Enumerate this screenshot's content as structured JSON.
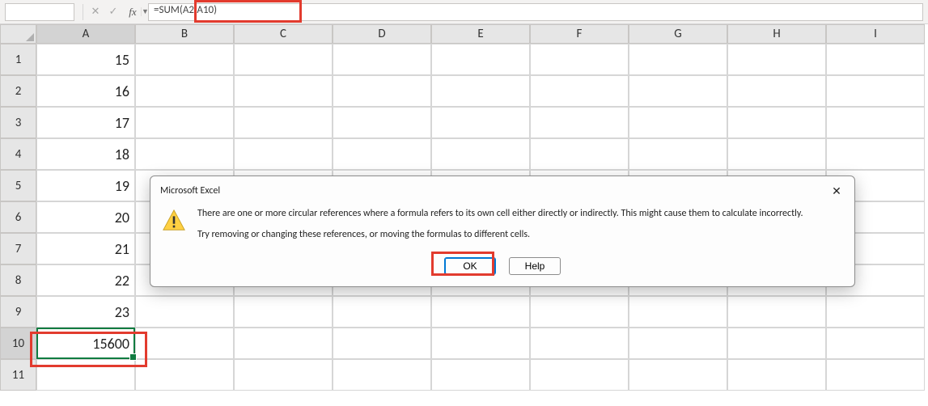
{
  "formula_bar": {
    "name_box_value": "",
    "fx_label": "fx",
    "formula_value": "=SUM(A2:A10)"
  },
  "columns": [
    "A",
    "B",
    "C",
    "D",
    "E",
    "F",
    "G",
    "H",
    "I"
  ],
  "rows": [
    1,
    2,
    3,
    4,
    5,
    6,
    7,
    8,
    9,
    10,
    11
  ],
  "cells": {
    "A1": "15",
    "A2": "16",
    "A3": "17",
    "A4": "18",
    "A5": "19",
    "A6": "20",
    "A7": "21",
    "A8": "22",
    "A9": "23",
    "A10": "15600"
  },
  "active_cell": "A10",
  "dialog": {
    "title": "Microsoft Excel",
    "line1": "There are one or more circular references where a formula refers to its own cell either directly or indirectly. This might cause them to calculate incorrectly.",
    "line2": "Try removing or changing these references, or moving the formulas to different cells.",
    "ok_label": "OK",
    "help_label": "Help"
  }
}
